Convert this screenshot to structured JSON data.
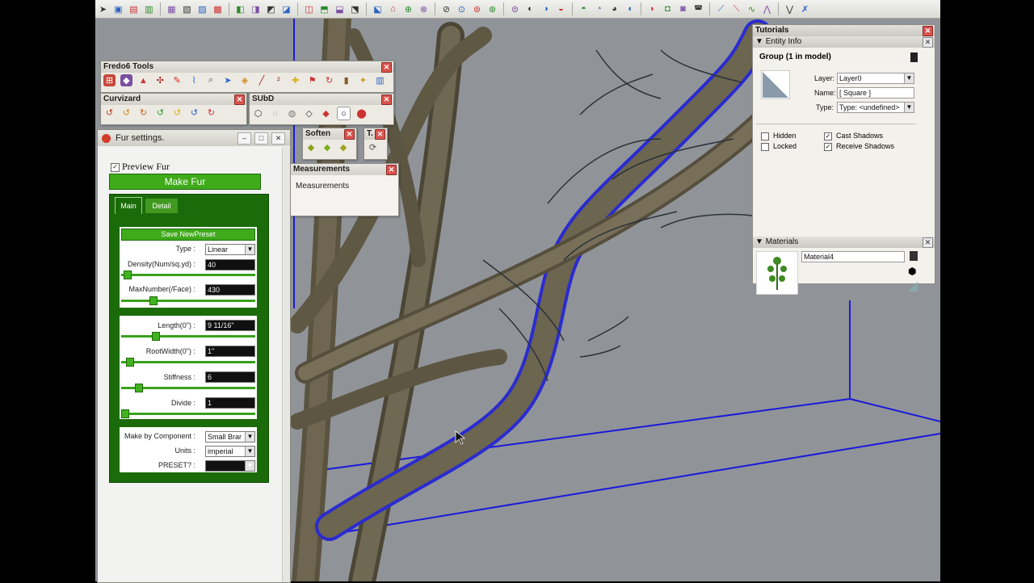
{
  "toolbar": {
    "icons": [
      "select-tool-icon",
      "component-icon",
      "paint-bucket-icon",
      "eraser-icon",
      "line-tool-icon",
      "arc-tool-icon",
      "rectangle-tool-icon",
      "push-pull-icon",
      "move-tool-icon",
      "rotate-tool-icon",
      "scale-tool-icon",
      "offset-tool-icon",
      "tape-measure-icon",
      "dimension-icon",
      "protractor-icon",
      "text-icon",
      "axes-icon",
      "3d-text-icon",
      "orbit-icon",
      "pan-icon",
      "zoom-icon",
      "zoom-extents-icon",
      "previous-view-icon",
      "next-view-icon",
      "iso-view-icon",
      "top-view-icon",
      "front-view-icon",
      "right-view-icon",
      "back-view-icon",
      "left-view-icon",
      "xray-icon",
      "back-edges-icon",
      "wireframe-icon",
      "hidden-line-icon",
      "shaded-icon",
      "textured-icon",
      "monochrome-icon",
      "section-plane-icon",
      "curve-icon",
      "smooth-icon",
      "flatten-icon",
      "dimension-tool-icon"
    ]
  },
  "fredo_tools": {
    "title": "Fredo6 Tools"
  },
  "curvizard": {
    "title": "Curvizard"
  },
  "subd": {
    "title": "SUbD"
  },
  "soften": {
    "title": "Soften"
  },
  "small_panel": {
    "title": "T."
  },
  "measurements": {
    "title": "Measurements",
    "label": "Measurements"
  },
  "fur": {
    "window_title": "Fur settings.",
    "preview_label": "Preview Fur",
    "preview_checked": true,
    "make_button": "Make Fur",
    "tabs": [
      "Main",
      "Detail"
    ],
    "save_button": "Save NewPreset",
    "type_label": "Type :",
    "type_value": "Linear",
    "density_label": "Density(Num/sq.yd) :",
    "density_value": "40",
    "density_level": 0.02,
    "maxnumber_label": "MaxNumber(/Face) :",
    "maxnumber_value": "430",
    "maxnumber_level": 0.22,
    "length_label": "Length(0\") :",
    "length_value": "9 11/16\"",
    "length_level": 0.24,
    "rootwidth_label": "RootWidth(0\") :",
    "rootwidth_value": "1\"",
    "rootwidth_level": 0.04,
    "stiffness_label": "Stiffness :",
    "stiffness_value": "6",
    "stiffness_level": 0.11,
    "divide_label": "Divide :",
    "divide_value": "1",
    "divide_level": 0.0,
    "make_by_label": "Make by Component :",
    "make_by_value": "Small Brar",
    "units_label": "Units :",
    "units_value": "imperial",
    "preset_label": "PRESET? :",
    "preset_value": ""
  },
  "tray": {
    "title": "Tutorials",
    "entity_info_title": "Entity Info",
    "selection_label": "Group (1 in model)",
    "layer_label": "Layer:",
    "layer_value": "Layer0",
    "name_label": "Name:",
    "name_value": "[ Square ]",
    "type_label": "Type:",
    "type_value": "Type: <undefined>",
    "hidden_label": "Hidden",
    "hidden_checked": false,
    "locked_label": "Locked",
    "locked_checked": false,
    "cast_label": "Cast Shadows",
    "cast_checked": true,
    "receive_label": "Receive Shadows",
    "receive_checked": true,
    "materials_title": "Materials",
    "material_name": "Material4"
  }
}
